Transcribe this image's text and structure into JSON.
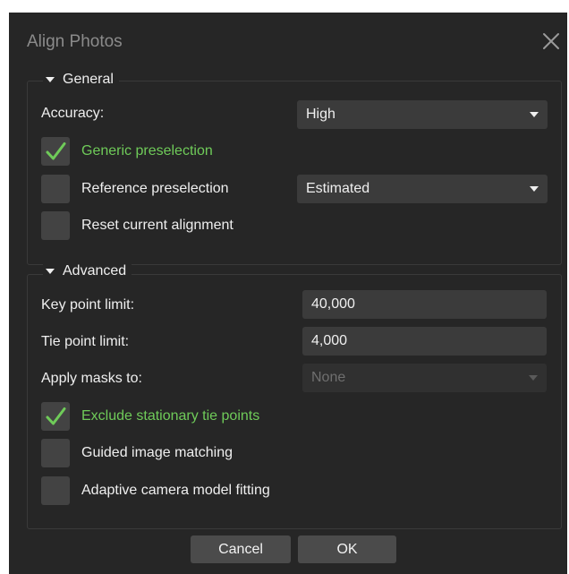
{
  "dialog": {
    "title": "Align Photos",
    "close_icon": "close-icon"
  },
  "general": {
    "legend": "General",
    "accuracy_label": "Accuracy:",
    "accuracy_value": "High",
    "generic_preselection": {
      "label": "Generic preselection",
      "checked": true
    },
    "reference_preselection": {
      "label": "Reference preselection",
      "checked": false,
      "value": "Estimated"
    },
    "reset_alignment": {
      "label": "Reset current alignment",
      "checked": false
    }
  },
  "advanced": {
    "legend": "Advanced",
    "key_point_label": "Key point limit:",
    "key_point_value": "40,000",
    "tie_point_label": "Tie point limit:",
    "tie_point_value": "4,000",
    "apply_masks_label": "Apply masks to:",
    "apply_masks_value": "None",
    "exclude_stationary": {
      "label": "Exclude stationary tie points",
      "checked": true
    },
    "guided_matching": {
      "label": "Guided image matching",
      "checked": false
    },
    "adaptive_fitting": {
      "label": "Adaptive camera model fitting",
      "checked": false
    }
  },
  "buttons": {
    "cancel": "Cancel",
    "ok": "OK"
  },
  "colors": {
    "dialog_bg": "#262626",
    "field_bg": "#3b3b3b",
    "checkbox_bg": "#434343",
    "checked_label": "#6fcb59",
    "text": "#efefef"
  }
}
